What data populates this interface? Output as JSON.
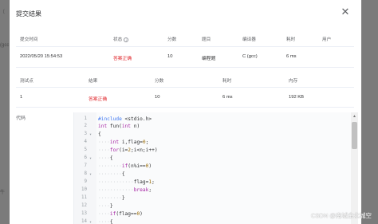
{
  "background": {
    "frag1": "〔",
    "frag2": "(gcc",
    "frag3": "牛"
  },
  "dialog": {
    "title": "提交结果",
    "close_icon": "close-icon",
    "submission_table": {
      "headers": [
        "提交时间",
        "状态",
        "分数",
        "题目",
        "编译器",
        "耗时",
        "用户"
      ],
      "row": [
        "2022/05/20 15:54:53",
        "答案正确",
        "10",
        "编程题",
        "C (gcc)",
        "6 ms",
        ""
      ]
    },
    "test_table": {
      "headers": [
        "测试点",
        "结果",
        "分数",
        "耗时",
        "内存"
      ],
      "row": [
        "1",
        "答案正确",
        "10",
        "6 ms",
        "192 KB"
      ]
    },
    "code_label": "代码",
    "code_lines": [
      "#include <stdio.h>",
      "int fun(int n)",
      "{",
      "····int i,flag=0;",
      "····for(i=2;i<n;i++)",
      "····{",
      "········if(n%i==0)",
      "········{",
      "············flag=1;",
      "············break;",
      "········}",
      "····}",
      "····if(flag==0)",
      "····{"
    ],
    "line_numbers": [
      "1",
      "2",
      "3",
      "4",
      "5",
      "6",
      "7",
      "8",
      "9",
      "10",
      "11",
      "12",
      "13",
      "14"
    ]
  },
  "colors": {
    "accepted": "#e0282d"
  },
  "watermark": "CSDN @南城余北城空"
}
